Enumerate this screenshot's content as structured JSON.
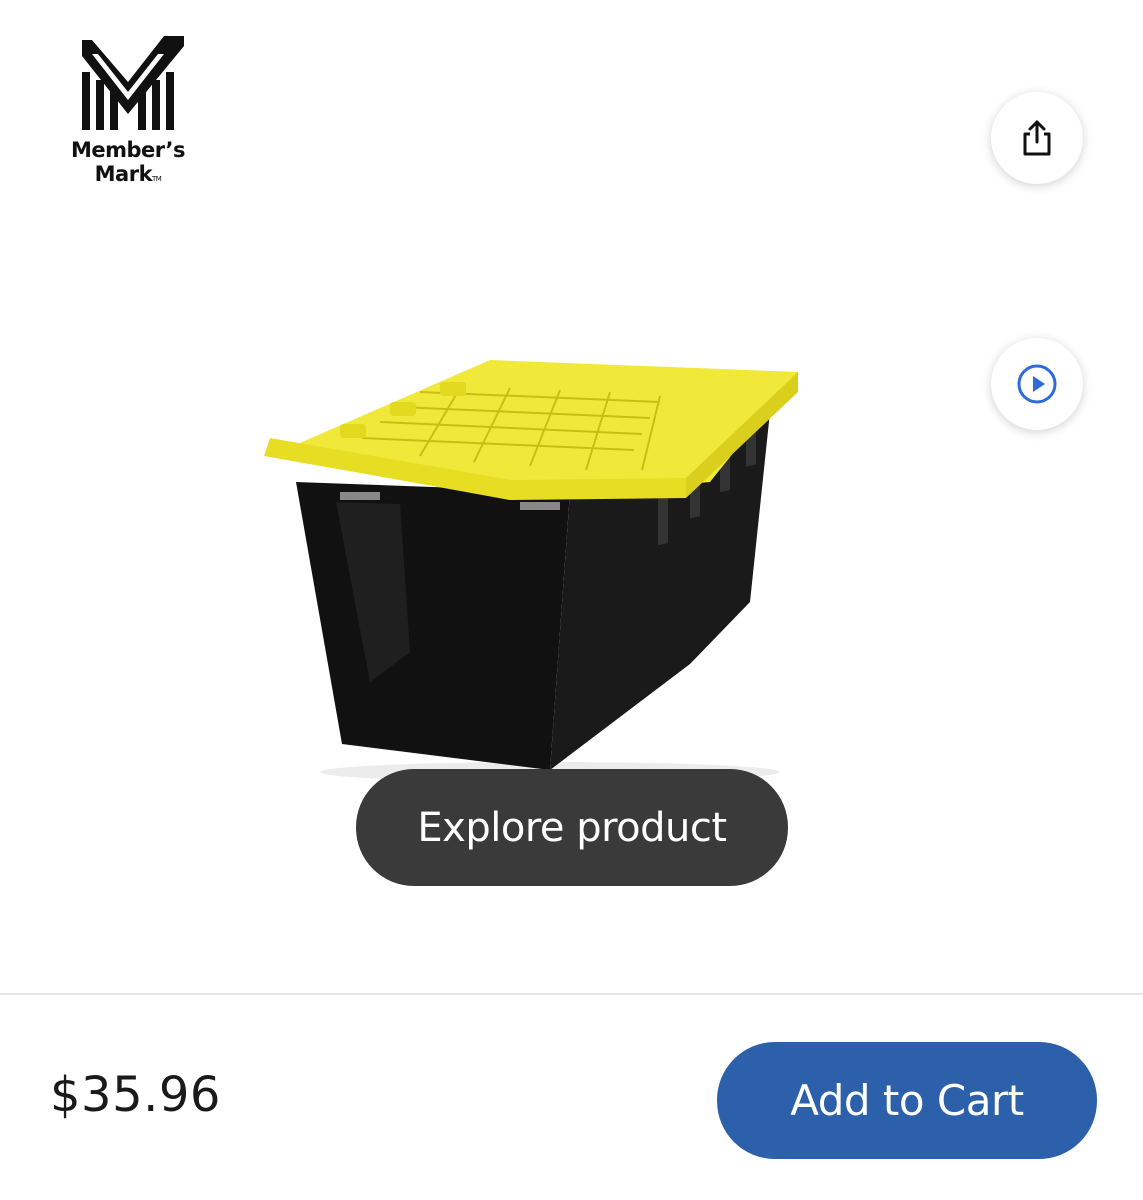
{
  "brand": {
    "name_line1": "Member’s",
    "name_line2": "Mark",
    "trademark": "TM",
    "logo_icon": "members-mark-m-logo"
  },
  "gallery": {
    "share_icon": "share-icon",
    "video_icon": "play-circle-icon",
    "product_image": "storage-tote-black-yellow-lid",
    "explore_label": "Explore product"
  },
  "footer": {
    "price": "$35.96",
    "add_to_cart_label": "Add to Cart"
  },
  "colors": {
    "cart_button": "#2d60ab",
    "explore_button": "#3a3a3a",
    "video_icon": "#2d6bdc",
    "lid_yellow": "#f1e93a",
    "tote_black": "#111111"
  }
}
